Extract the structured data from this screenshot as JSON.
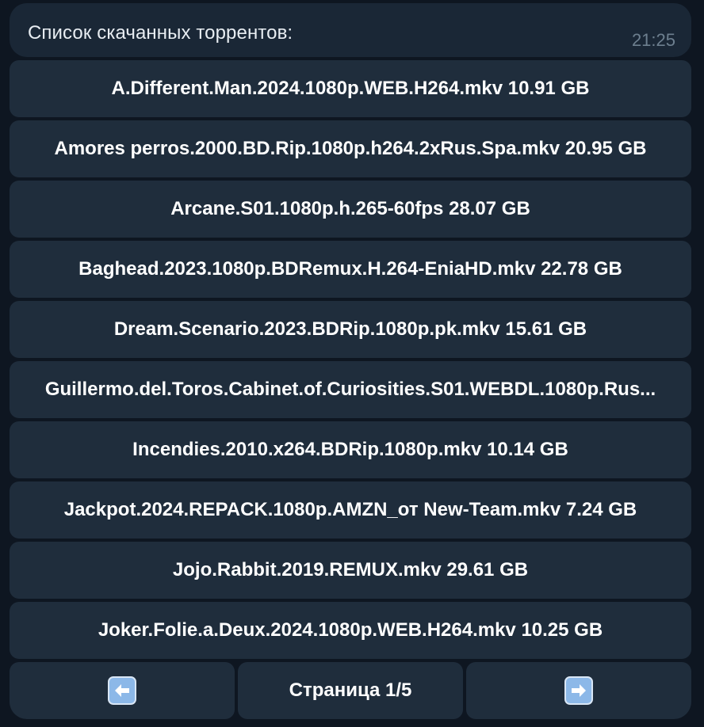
{
  "message": {
    "text": "Список скачанных торрентов:",
    "time": "21:25"
  },
  "torrents": [
    "A.Different.Man.2024.1080p.WEB.H264.mkv 10.91 GB",
    "Amores perros.2000.BD.Rip.1080p.h264.2xRus.Spa.mkv 20.95 GB",
    "Arcane.S01.1080p.h.265-60fps 28.07 GB",
    "Baghead.2023.1080p.BDRemux.H.264-EniaHD.mkv 22.78 GB",
    "Dream.Scenario.2023.BDRip.1080p.pk.mkv 15.61 GB",
    "Guillermo.del.Toros.Cabinet.of.Curiosities.S01.WEBDL.1080p.Rus...",
    "Incendies.2010.x264.BDRip.1080p.mkv 10.14 GB",
    "Jackpot.2024.REPACK.1080p.AMZN_от New-Team.mkv 7.24 GB",
    "Jojo.Rabbit.2019.REMUX.mkv 29.61 GB",
    "Joker.Folie.a.Deux.2024.1080p.WEB.H264.mkv 10.25 GB"
  ],
  "pagination": {
    "prev_icon": "left-arrow-icon",
    "page_label": "Страница 1/5",
    "next_icon": "right-arrow-icon"
  },
  "colors": {
    "background": "#0e1621",
    "bubble": "#1a2736",
    "button": "#1f2d3c",
    "arrow_icon": "#8cb8e8"
  }
}
